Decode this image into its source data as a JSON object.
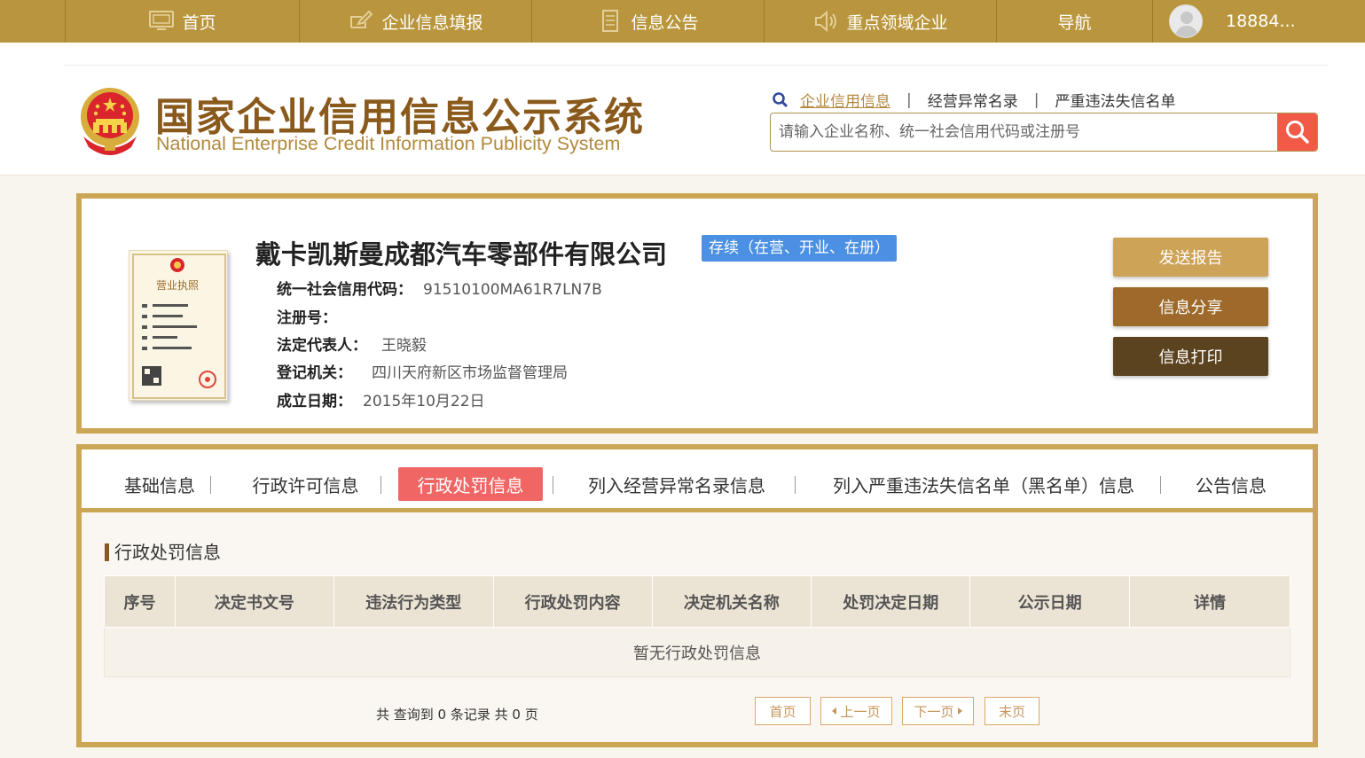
{
  "nav": {
    "items": [
      {
        "label": "首页",
        "icon": "monitor-icon"
      },
      {
        "label": "企业信息填报",
        "icon": "edit-icon"
      },
      {
        "label": "信息公告",
        "icon": "document-icon"
      },
      {
        "label": "重点领域企业",
        "icon": "speaker-icon"
      },
      {
        "label": "导航",
        "icon": ""
      }
    ],
    "user_label": "18884..."
  },
  "header": {
    "title": "国家企业信用信息公示系统",
    "subtitle": "National Enterprise Credit Information Publicity System",
    "search_links": [
      "企业信用信息",
      "经营异常名录",
      "严重违法失信名单"
    ],
    "search_placeholder": "请输入企业名称、统一社会信用代码或注册号"
  },
  "company": {
    "name": "戴卡凯斯曼成都汽车零部件有限公司",
    "status": "存续（在营、开业、在册）",
    "license_heading": "营业执照",
    "fields": [
      {
        "label": "统一社会信用代码：",
        "value": "91510100MA61R7LN7B"
      },
      {
        "label": "注册号：",
        "value": ""
      },
      {
        "label": "法定代表人：",
        "value": "王晓毅"
      },
      {
        "label": "登记机关：",
        "value": "四川天府新区市场监督管理局"
      },
      {
        "label": "成立日期：",
        "value": "2015年10月22日"
      }
    ],
    "actions": [
      "发送报告",
      "信息分享",
      "信息打印"
    ]
  },
  "tabs": {
    "items": [
      "基础信息",
      "行政许可信息",
      "行政处罚信息",
      "列入经营异常名录信息",
      "列入严重违法失信名单（黑名单）信息",
      "公告信息"
    ],
    "active_index": 2
  },
  "penalty": {
    "section_title": "行政处罚信息",
    "columns": [
      "序号",
      "决定书文号",
      "违法行为类型",
      "行政处罚内容",
      "决定机关名称",
      "处罚决定日期",
      "公示日期",
      "详情"
    ],
    "empty_text": "暂无行政处罚信息",
    "pager_info": "共 查询到 0 条记录 共 0 页",
    "pager": {
      "first": "首页",
      "prev": "上一页",
      "next": "下一页",
      "last": "末页"
    }
  },
  "colors": {
    "nav_bg": "#b9963d",
    "brand_brown": "#8a5a1c",
    "frame_gold": "#cba654",
    "active_tab": "#f06665",
    "status_badge": "#4b90e2",
    "search_button": "#f25a48"
  }
}
